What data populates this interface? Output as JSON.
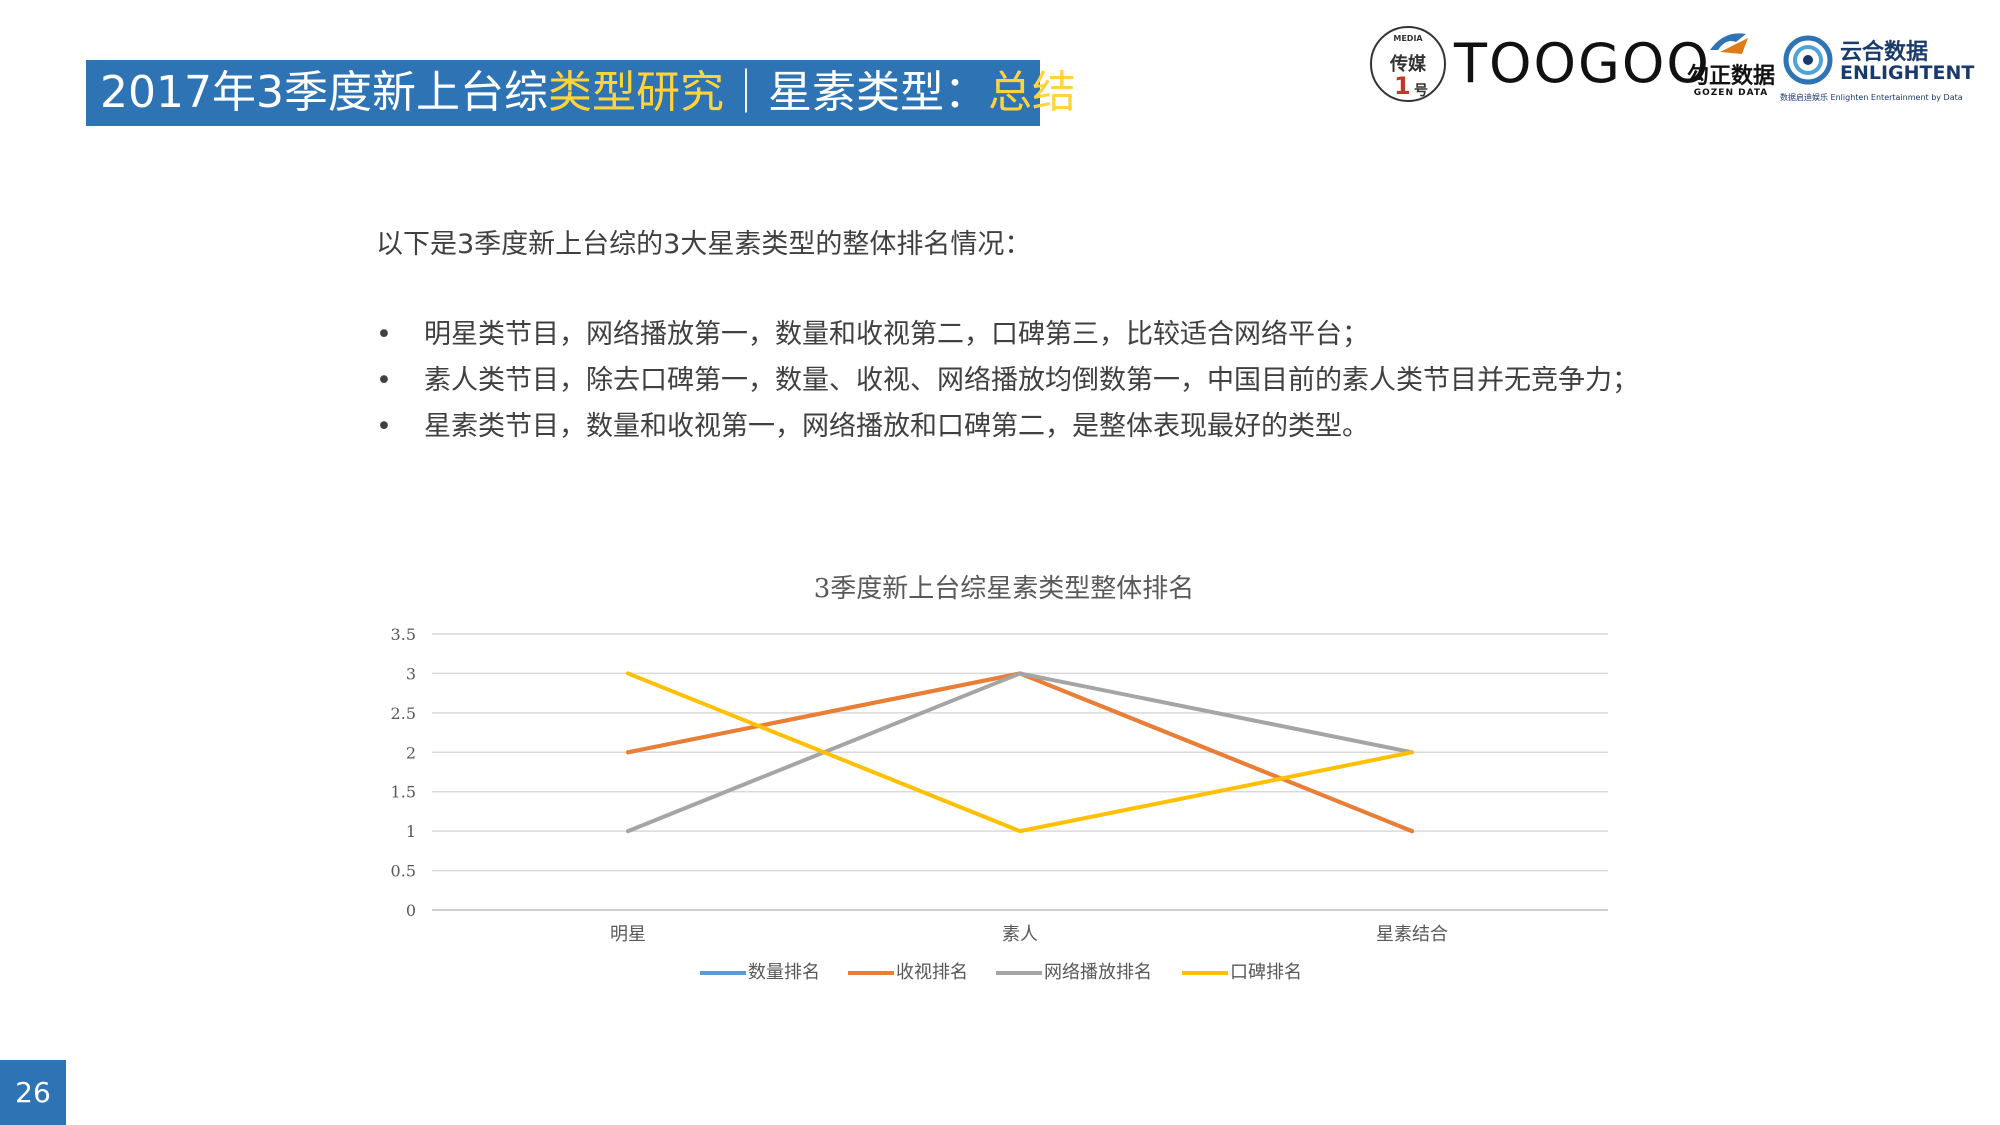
{
  "header": {
    "title_part1": "2017年3季度新上台综",
    "title_part2": "类型研究",
    "title_part3": "｜星素类型：",
    "title_part4": "总结"
  },
  "logos": {
    "media_small": "MEDIA",
    "media_name": "传媒",
    "media_num": "1",
    "media_suffix": "号",
    "toogoo": "TOOGOO",
    "gozen_cn": "勾正数据",
    "gozen_en": "GOZEN DATA",
    "enlightent_cn": "云合数据",
    "enlightent_en": "ENLIGHTENT",
    "enlightent_tagline": "数据启迪娱乐 Enlighten Entertainment by Data"
  },
  "content": {
    "intro": "以下是3季度新上台综的3大星素类型的整体排名情况：",
    "bullets": [
      "明星类节目，网络播放第一，数量和收视第二，口碑第三，比较适合网络平台；",
      "素人类节目，除去口碑第一，数量、收视、网络播放均倒数第一，中国目前的素人类节目并无竞争力；",
      "星素类节目，数量和收视第一，网络播放和口碑第二，是整体表现最好的类型。"
    ]
  },
  "chart_data": {
    "type": "line",
    "title": "3季度新上台综星素类型整体排名",
    "categories": [
      "明星",
      "素人",
      "星素结合"
    ],
    "ylim": [
      0,
      3.5
    ],
    "yticks": [
      "0",
      "0.5",
      "1",
      "1.5",
      "2",
      "2.5",
      "3",
      "3.5"
    ],
    "grid": true,
    "legend_position": "bottom",
    "series": [
      {
        "name": "数量排名",
        "color": "#5b9bd5",
        "values": [
          2,
          3,
          1
        ]
      },
      {
        "name": "收视排名",
        "color": "#ed7d31",
        "values": [
          2,
          3,
          1
        ]
      },
      {
        "name": "网络播放排名",
        "color": "#a5a5a5",
        "values": [
          1,
          3,
          2
        ]
      },
      {
        "name": "口碑排名",
        "color": "#ffc000",
        "values": [
          3,
          1,
          2
        ]
      }
    ]
  },
  "footer": {
    "page_number": "26"
  },
  "colors": {
    "accent": "#2e74b5",
    "highlight": "#ffd43b"
  }
}
